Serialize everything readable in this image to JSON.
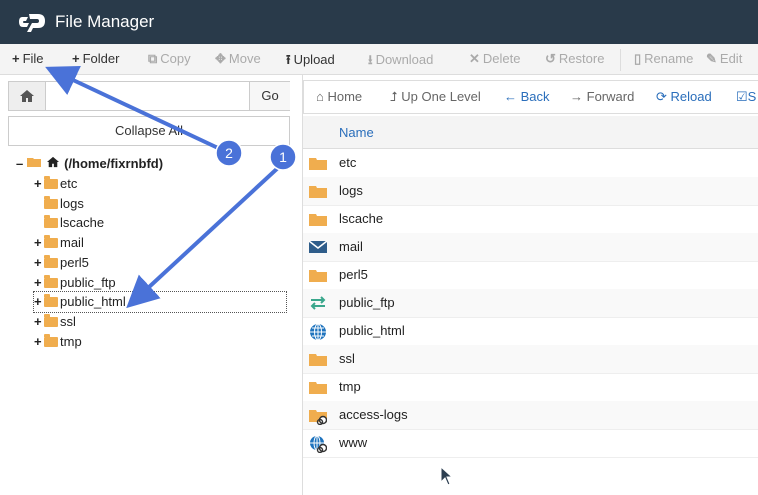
{
  "app": {
    "title": "File Manager"
  },
  "toolbar": {
    "file": "File",
    "folder": "Folder",
    "copy": "Copy",
    "move": "Move",
    "upload": "Upload",
    "download": "Download",
    "delete": "Delete",
    "restore": "Restore",
    "rename": "Rename",
    "edit": "Edit"
  },
  "path": {
    "value": "",
    "go": "Go",
    "collapse": "Collapse All"
  },
  "tree": {
    "root": "(/home/fixrnbfd)",
    "items": [
      {
        "label": "etc",
        "expandable": true
      },
      {
        "label": "logs",
        "expandable": false
      },
      {
        "label": "lscache",
        "expandable": false
      },
      {
        "label": "mail",
        "expandable": true
      },
      {
        "label": "perl5",
        "expandable": true
      },
      {
        "label": "public_ftp",
        "expandable": true
      },
      {
        "label": "public_html",
        "expandable": true
      },
      {
        "label": "ssl",
        "expandable": true
      },
      {
        "label": "tmp",
        "expandable": true
      }
    ]
  },
  "nav": {
    "home": "Home",
    "up": "Up One Level",
    "back": "Back",
    "forward": "Forward",
    "reload": "Reload",
    "select": "S"
  },
  "table": {
    "header": "Name",
    "rows": [
      {
        "name": "etc",
        "icon": "folder-icon"
      },
      {
        "name": "logs",
        "icon": "folder-icon"
      },
      {
        "name": "lscache",
        "icon": "folder-icon"
      },
      {
        "name": "mail",
        "icon": "mail-icon"
      },
      {
        "name": "perl5",
        "icon": "folder-icon"
      },
      {
        "name": "public_ftp",
        "icon": "transfer-arrows-icon"
      },
      {
        "name": "public_html",
        "icon": "globe-icon"
      },
      {
        "name": "ssl",
        "icon": "folder-icon"
      },
      {
        "name": "tmp",
        "icon": "folder-icon"
      },
      {
        "name": "access-logs",
        "icon": "folder-link-icon"
      },
      {
        "name": "www",
        "icon": "globe-link-icon"
      }
    ]
  },
  "annotations": {
    "callout_1": "1",
    "callout_2": "2"
  },
  "colors": {
    "topbar": "#293a4a",
    "accent": "#2a6ebb",
    "folder": "#f0ad4e",
    "callout": "#4a72d8"
  }
}
